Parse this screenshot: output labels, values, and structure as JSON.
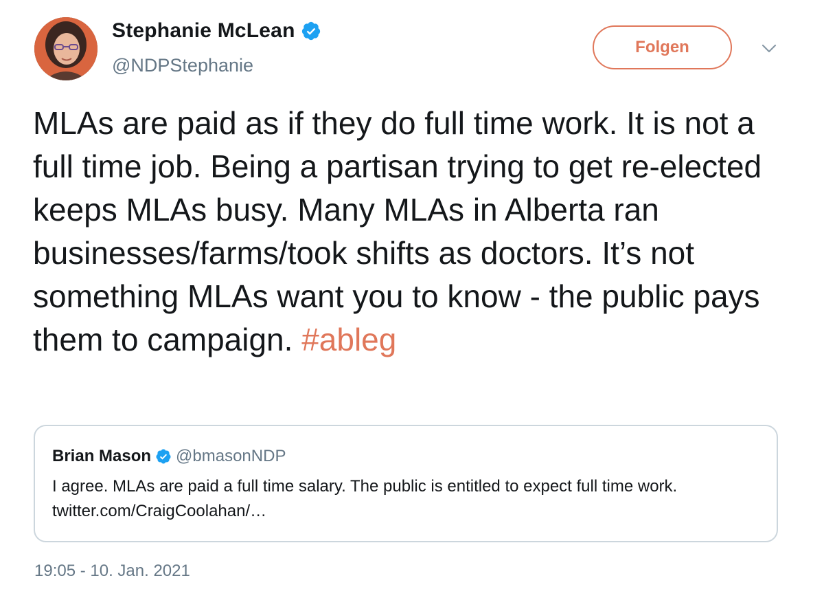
{
  "author": {
    "display_name": "Stephanie McLean",
    "handle": "@NDPStephanie",
    "verified": true
  },
  "actions": {
    "follow_label": "Folgen",
    "more_icon": "chevron-down-icon"
  },
  "tweet": {
    "text": "MLAs are paid as if they do full time work. It is not a full time job. Being a partisan trying to get re-elected keeps MLAs busy. Many MLAs in Alberta ran businesses/farms/took shifts as doctors. It’s not something MLAs want you to know - the public pays them to campaign.",
    "hashtag": "#ableg",
    "timestamp": "19:05 - 10. Jan. 2021"
  },
  "quoted_tweet": {
    "display_name": "Brian Mason",
    "handle": "@bmasonNDP",
    "verified": true,
    "text": "I agree. MLAs are paid a full time salary. The public is entitled to expect full time work. twitter.com/CraigCoolahan/…"
  },
  "colors": {
    "accent": "#e0775a",
    "verified_blue": "#1da1f2",
    "secondary_text": "#657786",
    "border": "#ccd6dd"
  }
}
